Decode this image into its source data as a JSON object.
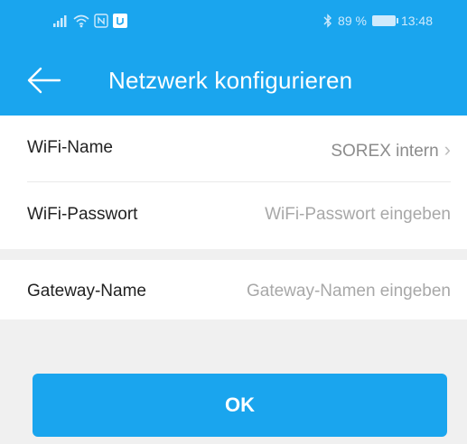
{
  "statusbar": {
    "battery_percent": "89 %",
    "time": "13:48",
    "icons_left": [
      "signal-icon",
      "wifi-icon",
      "nfc-icon",
      "app-notification-icon"
    ],
    "icons_right": [
      "bluetooth-icon",
      "battery-icon"
    ]
  },
  "toolbar": {
    "title": "Netzwerk konfigurieren",
    "back_icon": "arrow-left-icon"
  },
  "wifi_name": {
    "label": "WiFi-Name",
    "value": "SOREX intern"
  },
  "wifi_password": {
    "label": "WiFi-Passwort",
    "placeholder": "WiFi-Passwort eingeben"
  },
  "gateway_name": {
    "label": "Gateway-Name",
    "placeholder": "Gateway-Namen eingeben"
  },
  "ok_button": {
    "label": "OK"
  },
  "colors": {
    "primary": "#1aa5ee",
    "background": "#f0f0f0",
    "text": "#222222",
    "placeholder": "#a8a8a8"
  }
}
